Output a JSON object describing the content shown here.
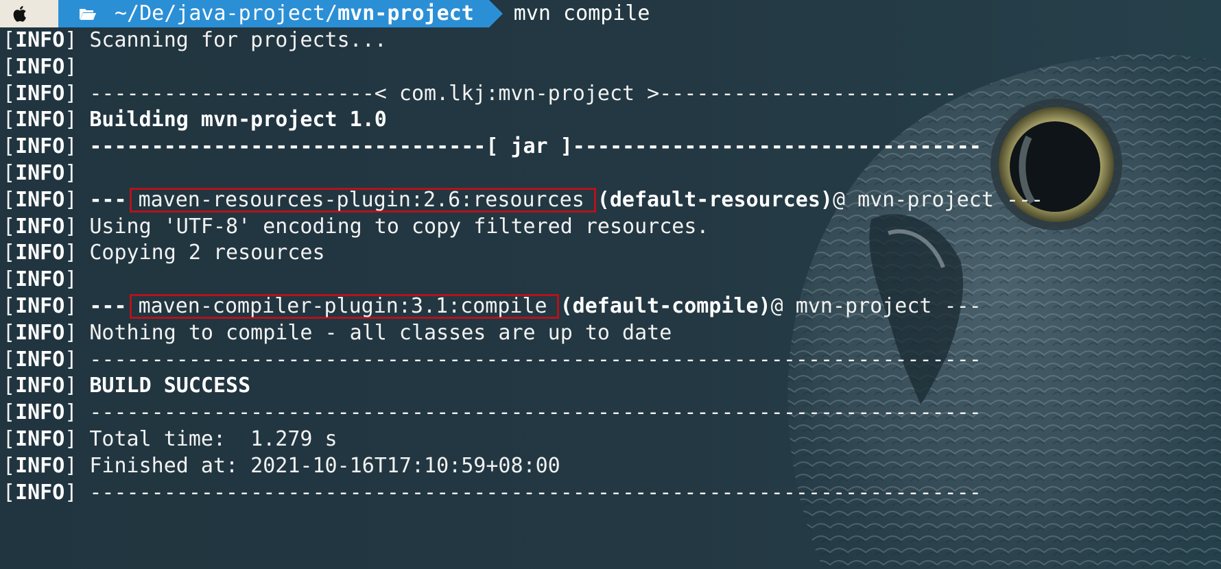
{
  "prompt": {
    "path_prefix": "~/De/java-project/",
    "path_current": "mvn-project",
    "command": "mvn compile"
  },
  "icons": {
    "apple": "apple-icon",
    "folder": "folder-open-icon"
  },
  "colors": {
    "prompt_path_bg": "#2b8fd6",
    "prompt_apple_bg": "#ece8dd",
    "terminal_bg": "#213540",
    "highlight_box": "#b3131b",
    "text": "#f2f2f2"
  },
  "log": {
    "tag_open": "[",
    "tag_level": "INFO",
    "tag_close": "]",
    "scanning": "Scanning for projects...",
    "project_rule": "-----------------------< com.lkj:mvn-project >------------------------",
    "building": "Building mvn-project 1.0",
    "jar_rule_left": "--------------------------------",
    "jar_rule_mid": "[ jar ]",
    "jar_rule_right": "---------------------------------",
    "resources_prefix": "---",
    "resources_plugin": "maven-resources-plugin:2.6:resources",
    "resources_exec": "(default-resources)",
    "resources_suffix": "@ mvn-project ---",
    "encoding": "Using 'UTF-8' encoding to copy filtered resources.",
    "copying": "Copying 2 resources",
    "compiler_prefix": "---",
    "compiler_plugin": "maven-compiler-plugin:3.1:compile",
    "compiler_exec": "(default-compile)",
    "compiler_suffix": "@ mvn-project ---",
    "nothing": "Nothing to compile - all classes are up to date",
    "rule": "------------------------------------------------------------------------",
    "build_success": "BUILD SUCCESS",
    "total_time": "Total time:  1.279 s",
    "finished_at": "Finished at: 2021-10-16T17:10:59+08:00"
  }
}
